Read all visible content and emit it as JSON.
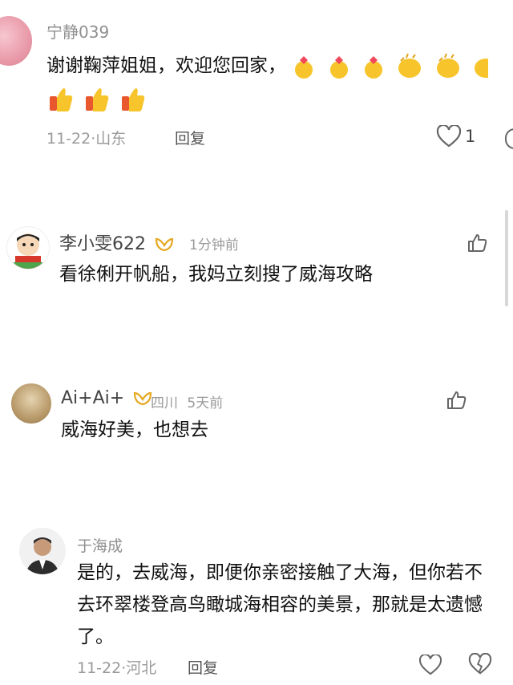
{
  "comments": [
    {
      "name": "宁静039",
      "text_line1": "谢谢鞠萍姐姐，欢迎您回家，",
      "date": "11-22",
      "location": "山东",
      "reply": "回复",
      "likes": "1",
      "emojis_line1": [
        "heart-hands",
        "heart-hands",
        "heart-hands",
        "clap",
        "clap",
        "clap"
      ],
      "emojis_line2": [
        "thumbs-up",
        "thumbs-up",
        "thumbs-up"
      ]
    },
    {
      "name": "李小雯622",
      "time": "1分钟前",
      "text": "看徐俐开帆船，我妈立刻搜了威海攻略"
    },
    {
      "name": "Ai+Ai+",
      "location": "四川",
      "time": "5天前",
      "text": "威海好美，也想去"
    },
    {
      "name": "于海成",
      "text_line1": "是的，去威海，即便你亲密接触了大海，但你若不",
      "text_line2": "去环翠楼登高鸟瞰城海相容的美景，那就是太遗憾",
      "text_line3": "了。",
      "date": "11-22",
      "location": "河北",
      "reply": "回复"
    }
  ],
  "colors": {
    "meta": "#9a9a9a",
    "badge": "#e5a823"
  }
}
